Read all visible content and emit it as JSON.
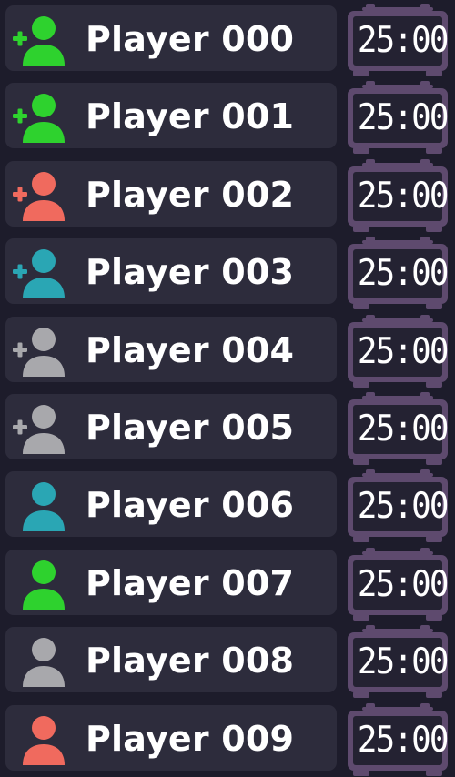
{
  "players": [
    {
      "name": "Player 000",
      "avatar_color": "#2ed22e",
      "has_add_badge": true,
      "timer": "25:00"
    },
    {
      "name": "Player 001",
      "avatar_color": "#2ed22e",
      "has_add_badge": true,
      "timer": "25:00"
    },
    {
      "name": "Player 002",
      "avatar_color": "#f06a5e",
      "has_add_badge": true,
      "timer": "25:00"
    },
    {
      "name": "Player 003",
      "avatar_color": "#2aa6b4",
      "has_add_badge": true,
      "timer": "25:00"
    },
    {
      "name": "Player 004",
      "avatar_color": "#a8a8ac",
      "has_add_badge": true,
      "timer": "25:00"
    },
    {
      "name": "Player 005",
      "avatar_color": "#a8a8ac",
      "has_add_badge": true,
      "timer": "25:00"
    },
    {
      "name": "Player 006",
      "avatar_color": "#2aa6b4",
      "has_add_badge": false,
      "timer": "25:00"
    },
    {
      "name": "Player 007",
      "avatar_color": "#2ed22e",
      "has_add_badge": false,
      "timer": "25:00"
    },
    {
      "name": "Player 008",
      "avatar_color": "#a8a8ac",
      "has_add_badge": false,
      "timer": "25:00"
    },
    {
      "name": "Player 009",
      "avatar_color": "#f06a5e",
      "has_add_badge": false,
      "timer": "25:00"
    }
  ],
  "icons": {
    "avatar": "person-icon",
    "add_badge": "plus-icon",
    "timer": "alarm-clock-icon"
  },
  "colors": {
    "background": "#1d1c2b",
    "card": "#2d2c3c",
    "clock_frame": "#5e4a6e",
    "clock_face": "#242232",
    "text": "#ffffff"
  }
}
